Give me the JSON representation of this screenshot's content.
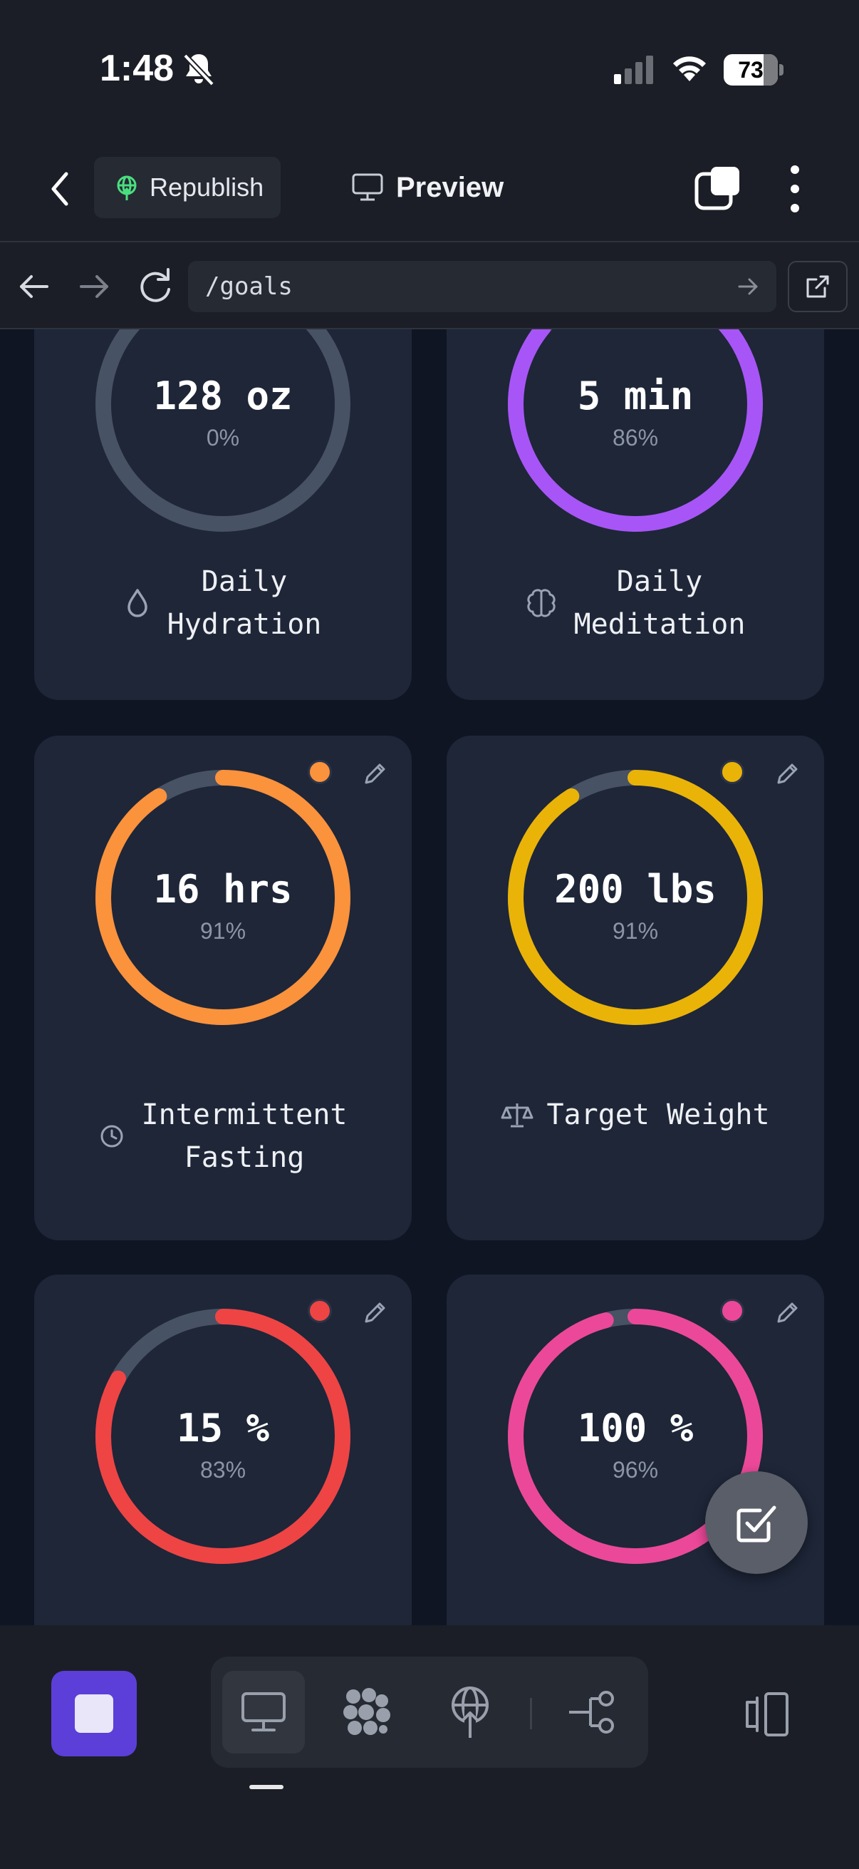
{
  "status_bar": {
    "time": "1:48",
    "battery": "73"
  },
  "header": {
    "republish_label": "Republish",
    "preview_label": "Preview"
  },
  "browser": {
    "url": "/goals"
  },
  "colors": {
    "hydration": "#4a5567",
    "meditation": "#a855f7",
    "fasting": "#fb923c",
    "weight": "#eab308",
    "bodyfat": "#ef4444",
    "other": "#ec4899",
    "track": "#475264",
    "stop_button": "#5b3fd8"
  },
  "goals": [
    {
      "value": "128 oz",
      "percent": "0%",
      "progress": 0,
      "label_lines": [
        "Daily",
        "Hydration"
      ],
      "icon": "droplet-icon",
      "color": "#4a5567"
    },
    {
      "value": "5 min",
      "percent": "86%",
      "progress": 86,
      "label_lines": [
        "Daily",
        "Meditation"
      ],
      "icon": "brain-icon",
      "color": "#a855f7"
    },
    {
      "value": "16 hrs",
      "percent": "91%",
      "progress": 91,
      "label_lines": [
        "Intermittent",
        "Fasting"
      ],
      "icon": "clock-icon",
      "color": "#fb923c"
    },
    {
      "value": "200 lbs",
      "percent": "91%",
      "progress": 91,
      "label_lines": [
        "Target Weight"
      ],
      "icon": "scale-icon",
      "color": "#eab308"
    },
    {
      "value": "15 %",
      "percent": "83%",
      "progress": 83,
      "label_lines": [],
      "icon": "",
      "color": "#ef4444"
    },
    {
      "value": "100 %",
      "percent": "96%",
      "progress": 96,
      "label_lines": [],
      "icon": "",
      "color": "#ec4899"
    }
  ],
  "toolbar": {
    "icons": [
      "stop-icon",
      "desktop-icon",
      "assets-icon",
      "publish-icon",
      "workflow-icon",
      "device-toggle-icon"
    ]
  }
}
